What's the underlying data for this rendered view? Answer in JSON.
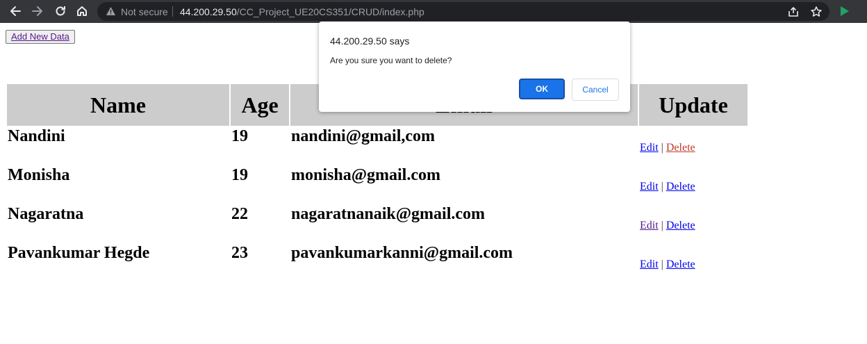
{
  "browser": {
    "security_label": "Not secure",
    "url_host": "44.200.29.50",
    "url_path": "/CC_Project_UE20CS351/CRUD/index.php",
    "icons": [
      "back-arrow-icon",
      "forward-arrow-icon",
      "reload-icon",
      "home-icon",
      "warning-icon",
      "share-icon",
      "star-icon",
      "extension-icon"
    ]
  },
  "page": {
    "add_button_label": "Add New Data",
    "table": {
      "headers": [
        "Name",
        "Age",
        "Email",
        "Update"
      ],
      "rows": [
        {
          "name": "Nandini",
          "age": "19",
          "email": "nandini@gmail,com",
          "edit": "Edit",
          "separator": "|",
          "delete": "Delete"
        },
        {
          "name": "Monisha",
          "age": "19",
          "email": "monisha@gmail.com",
          "edit": "Edit",
          "separator": "|",
          "delete": "Delete"
        },
        {
          "name": "Nagaratna",
          "age": "22",
          "email": "nagaratnanaik@gmail.com",
          "edit": "Edit",
          "separator": "|",
          "delete": "Delete"
        },
        {
          "name": "Pavankumar Hegde",
          "age": "23",
          "email": "pavankumarkanni@gmail.com",
          "edit": "Edit",
          "separator": "|",
          "delete": "Delete"
        }
      ]
    }
  },
  "dialog": {
    "title": "44.200.29.50 says",
    "message": "Are you sure you want to delete?",
    "ok_label": "OK",
    "cancel_label": "Cancel"
  },
  "colors": {
    "chrome_bg": "#35363a",
    "omnibox_bg": "#202124",
    "table_header_bg": "#cccccc",
    "link": "#0000ee",
    "visited_link": "#551a8b",
    "active_delete_link": "#c0392b",
    "ok_button": "#1a73e8"
  }
}
